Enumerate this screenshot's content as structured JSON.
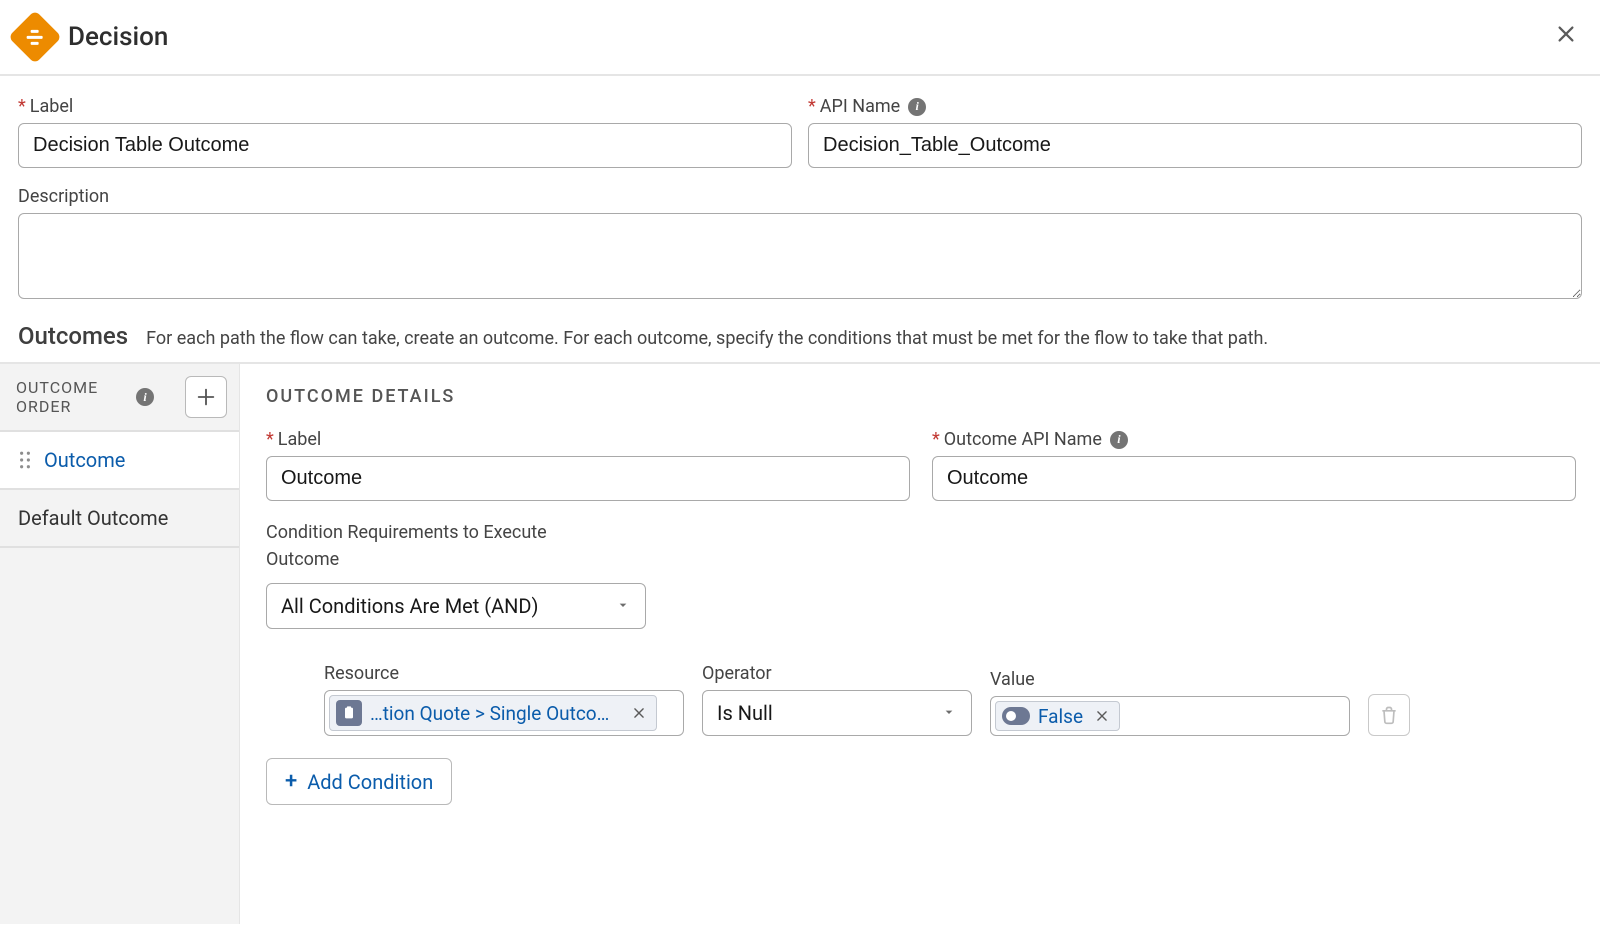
{
  "header": {
    "title": "Decision"
  },
  "labels": {
    "label": "Label",
    "api_name": "API Name",
    "description": "Description"
  },
  "fields": {
    "label_value": "Decision Table Outcome",
    "api_name_value": "Decision_Table_Outcome",
    "description_value": ""
  },
  "outcomes": {
    "heading": "Outcomes",
    "help": "For each path the flow can take, create an outcome. For each outcome, specify the conditions that must be met for the flow to take that path."
  },
  "sidebar": {
    "header": "OUTCOME ORDER",
    "items": [
      {
        "label": "Outcome",
        "active": true,
        "draggable": true
      },
      {
        "label": "Default Outcome",
        "active": false,
        "draggable": false
      }
    ]
  },
  "details": {
    "heading": "OUTCOME DETAILS",
    "label_label": "Label",
    "label_value": "Outcome",
    "api_label": "Outcome API Name",
    "api_value": "Outcome",
    "cond_req_label": "Condition Requirements to Execute Outcome",
    "cond_req_value": "All Conditions Are Met (AND)",
    "columns": {
      "resource": "Resource",
      "operator": "Operator",
      "value": "Value"
    },
    "condition": {
      "resource_text": "…tion Quote > Single Outcome",
      "operator": "Is Null",
      "value_text": "False"
    },
    "add_condition": "Add Condition"
  }
}
